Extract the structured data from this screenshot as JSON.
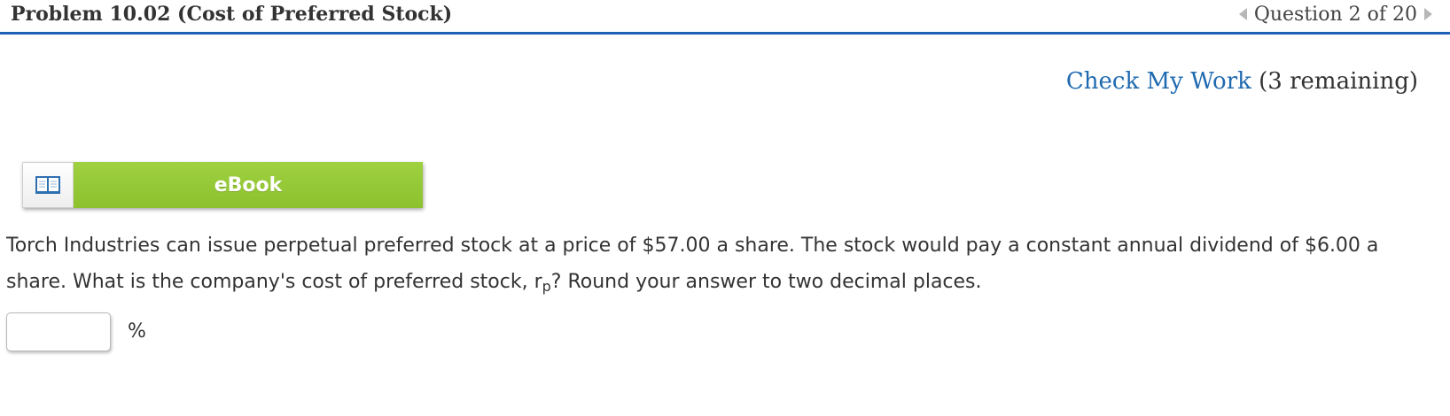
{
  "header": {
    "problem_title": "Problem 10.02 (Cost of Preferred Stock)",
    "question_nav": "Question 2 of 20",
    "prev_icon": "triangle-left-icon",
    "next_icon": "triangle-right-icon"
  },
  "check_work": {
    "link_label": "Check My Work",
    "remaining": "(3 remaining)"
  },
  "ebook": {
    "label": "eBook",
    "icon": "open-book-icon"
  },
  "question": {
    "text_part1": "Torch Industries can issue perpetual preferred stock at a price of $57.00 a share. The stock would pay a constant annual dividend of $6.00 a share. What is the company's cost of preferred stock, r",
    "subscript": "p",
    "text_part2": "? Round your answer to two decimal places."
  },
  "answer": {
    "value": "",
    "placeholder": "",
    "unit": "%"
  },
  "colors": {
    "header_rule": "#1f5fb4",
    "link": "#1f6ab0",
    "ebook_green": "#93c634",
    "nav_arrow": "#b7b7b7"
  }
}
